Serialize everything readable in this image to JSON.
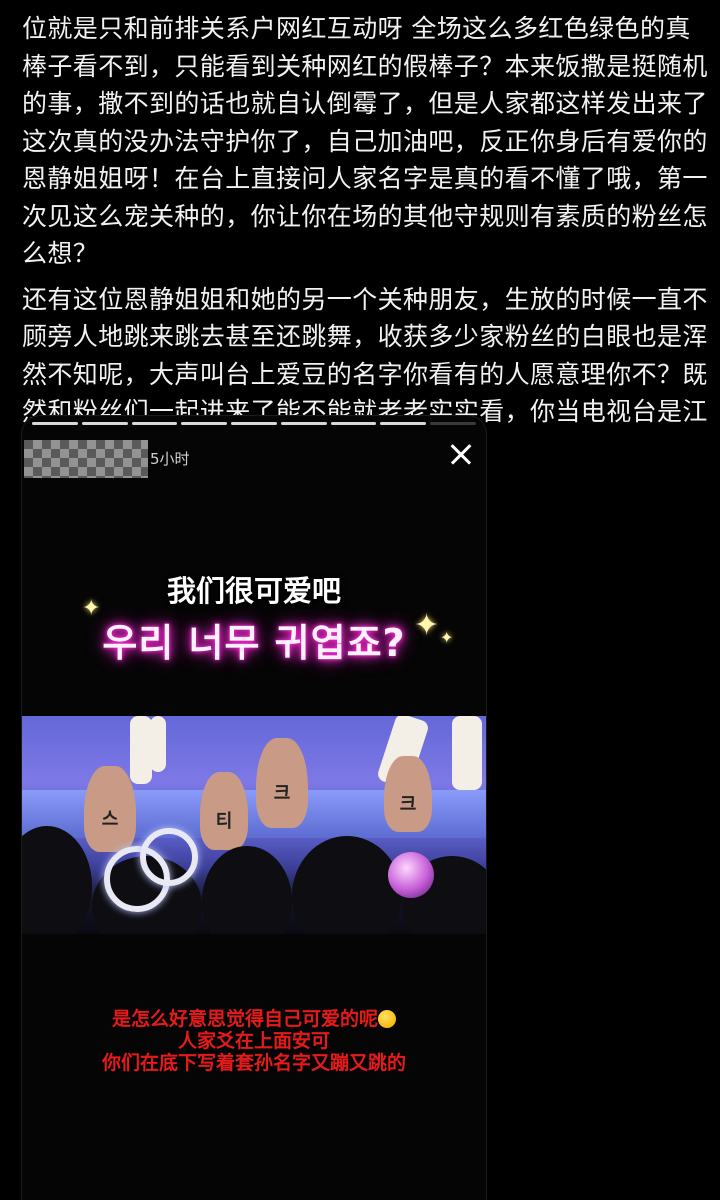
{
  "post": {
    "paragraph1": "位就是只和前排关系户网红互动呀 全场这么多红色绿色的真棒子看不到，只能看到关种网红的假棒子？本来饭撒是挺随机的事，撒不到的话也就自认倒霉了，但是人家都这样发出来了这次真的没办法守护你了，自己加油吧，反正你身后有爱你的恩静姐姐呀！在台上直接问人家名字是真的看不懂了哦，第一次见这么宠关种的，你让你在场的其他守规则有素质的粉丝怎么想？",
    "paragraph2": "还有这位恩静姐姐和她的另一个关种朋友，生放的时候一直不顾旁人地跳来跳去甚至还跳舞，收获多少家粉丝的白眼也是浑然不知呢，大声叫台上爱豆的名字你看有的人愿意理你不？既然和粉丝们一起进来了能不能就老老实实看，你当电视台是江南club？",
    "trailing_emoji": "grinning-sweat-emoji"
  },
  "story": {
    "time_ago": "5小时",
    "caption_cn": "我们很可爱吧",
    "caption_kr": "우리 너무 귀엽죠?",
    "hand_letters": [
      "스",
      "티",
      "크",
      "크"
    ],
    "bottom_line1": "是怎么好意思觉得自己可爱的呢",
    "bottom_line2": "人家爻在上面安可",
    "bottom_line3": "你们在底下写着套孙名字又蹦又跳的",
    "colors": {
      "background": "#000000",
      "kr_glow": "#ff2bd6",
      "bottom_text": "#e51a1a"
    }
  }
}
